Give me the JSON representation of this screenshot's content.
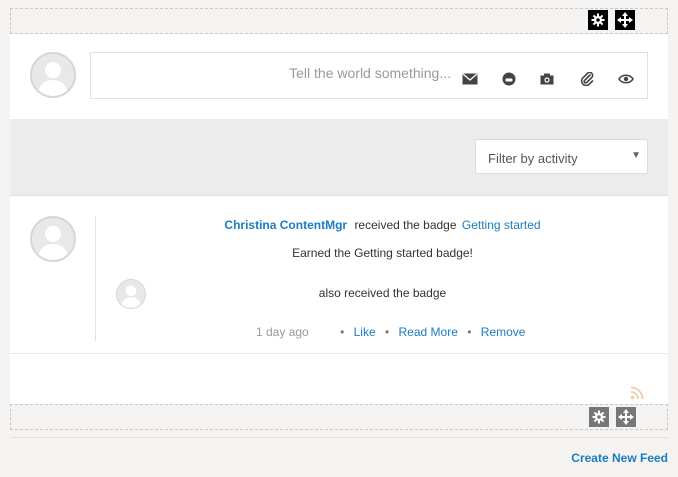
{
  "composer": {
    "placeholder": "Tell the world something..."
  },
  "filter": {
    "selected": "Filter by activity"
  },
  "post": {
    "author": "Christina ContentMgr",
    "action_text": "received the badge",
    "badge_link": "Getting started",
    "body": "Earned the Getting started badge!",
    "also_text": "also received the badge",
    "time": "1 day ago",
    "actions": {
      "like": "Like",
      "read_more": "Read More",
      "remove": "Remove",
      "separator": "•"
    }
  },
  "footer": {
    "create_feed": "Create New Feed"
  },
  "icons": {
    "top_toolbar": [
      "gear-icon",
      "move-icon"
    ],
    "composer": [
      "envelope-icon",
      "emoji-icon",
      "camera-icon",
      "paperclip-icon",
      "eye-icon"
    ],
    "bottom_toolbar": [
      "gear-icon",
      "move-icon"
    ],
    "feed": [
      "rss-icon"
    ]
  },
  "colors": {
    "link": "#1a7cc1",
    "page_bg": "#f4f3f1",
    "filter_bar_bg": "#ececec"
  }
}
